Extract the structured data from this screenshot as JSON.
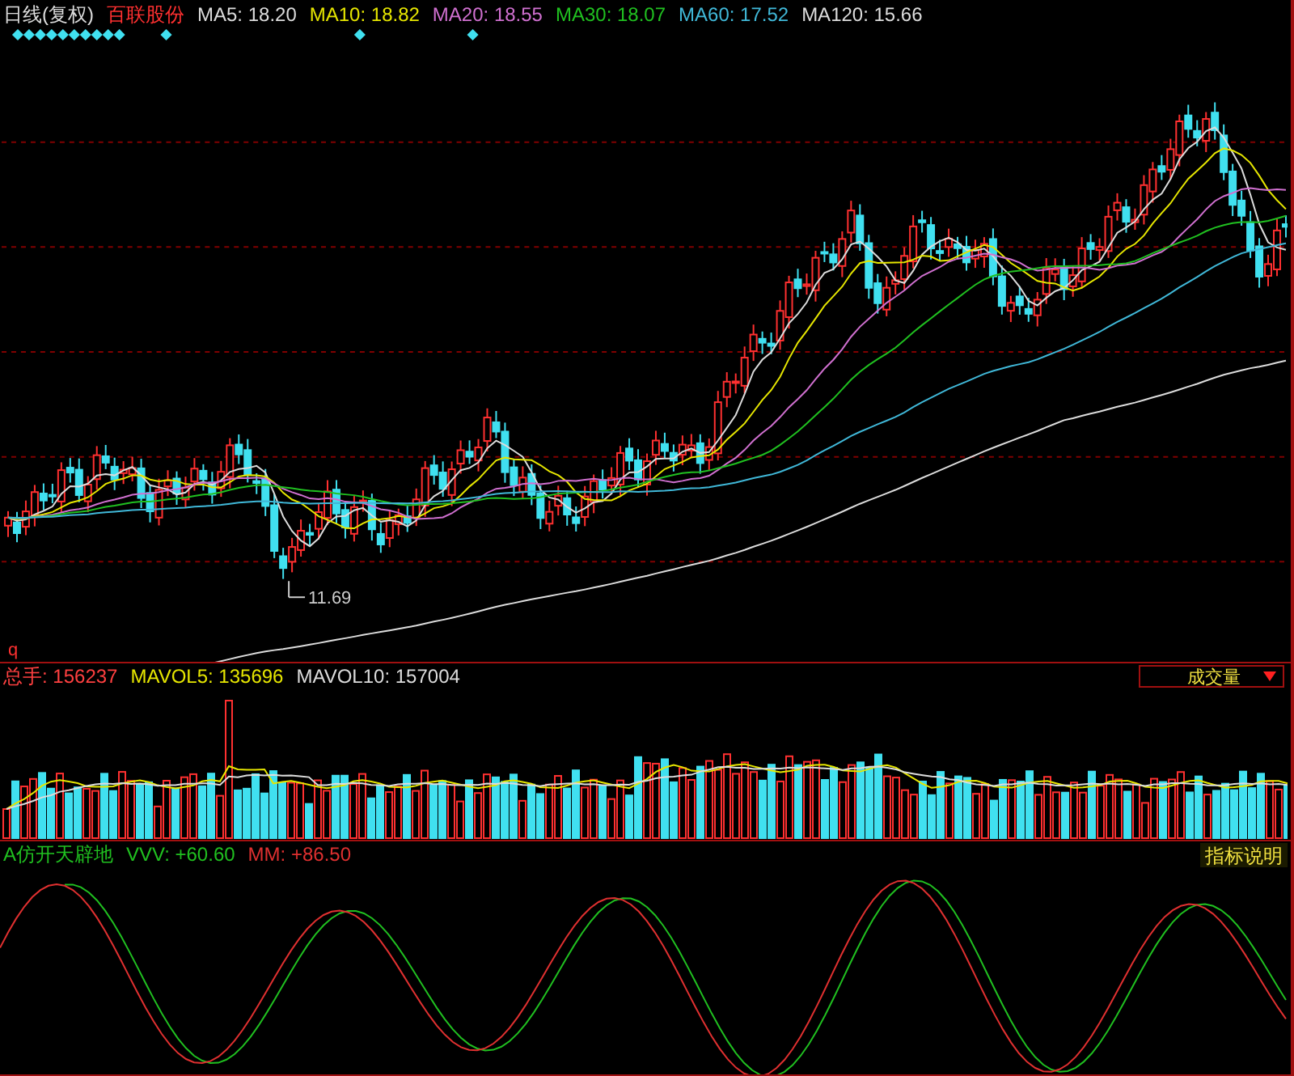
{
  "main": {
    "period": "日线(复权)",
    "stock_name": "百联股份",
    "ma_values": [
      {
        "label": "MA5: 18.20",
        "color": "#dcdcdc"
      },
      {
        "label": "MA10: 18.82",
        "color": "#e6e600"
      },
      {
        "label": "MA20: 18.55",
        "color": "#d070d0"
      },
      {
        "label": "MA30: 18.07",
        "color": "#20c020"
      },
      {
        "label": "MA60: 17.52",
        "color": "#40b8d8"
      },
      {
        "label": "MA120: 15.66",
        "color": "#dcdcdc"
      }
    ],
    "low_marker": "11.69",
    "corner_mark": "q"
  },
  "volume": {
    "values": [
      {
        "label": "总手: 156237",
        "color": "#ff4040"
      },
      {
        "label": "MAVOL5: 135696",
        "color": "#e6e600"
      },
      {
        "label": "MAVOL10: 157004",
        "color": "#dcdcdc"
      }
    ],
    "selector": "成交量"
  },
  "indicator": {
    "name": "A仿开天辟地",
    "values": [
      {
        "label": "VVV: +60.60",
        "color": "#20c020"
      },
      {
        "label": "MM: +86.50",
        "color": "#e03030"
      }
    ],
    "help": "指标说明"
  }
}
